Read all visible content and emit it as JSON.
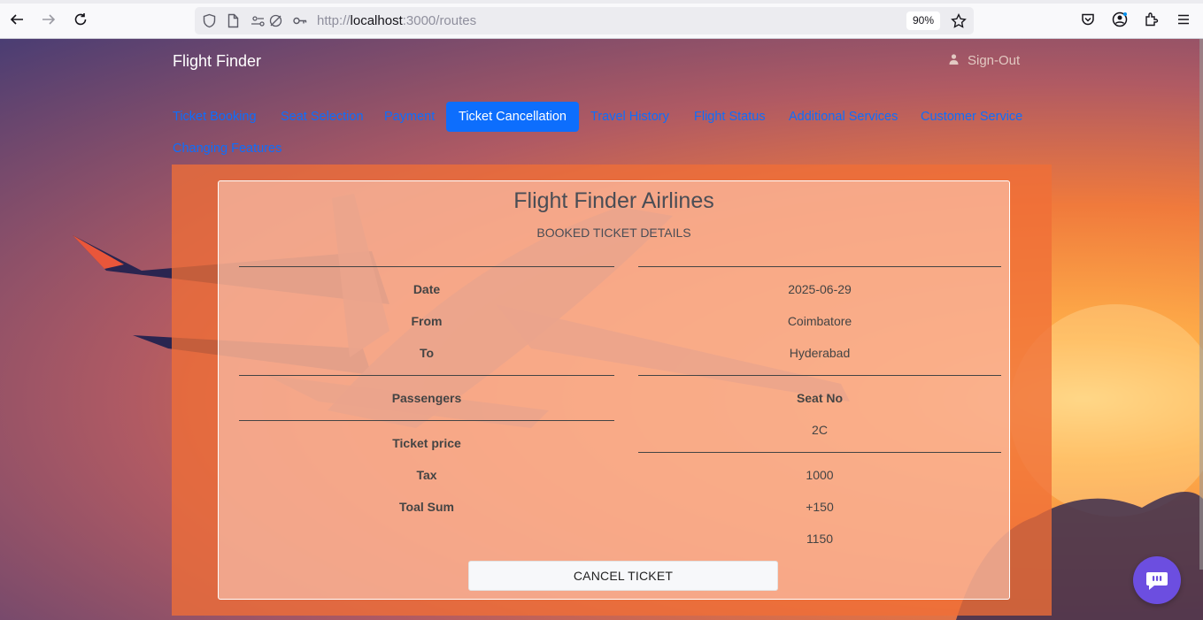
{
  "browser": {
    "url_prefix": "http://",
    "url_host": "localhost",
    "url_path": ":3000/routes",
    "zoom": "90%"
  },
  "header": {
    "brand": "Flight Finder",
    "signout_label": "Sign-Out"
  },
  "nav": {
    "tabs": [
      {
        "label": "Ticket Booking",
        "active": false
      },
      {
        "label": "Seat Selection",
        "active": false
      },
      {
        "label": "Payment",
        "active": false
      },
      {
        "label": "Ticket Cancellation",
        "active": true
      },
      {
        "label": "Travel History",
        "active": false
      },
      {
        "label": "Flight Status",
        "active": false
      },
      {
        "label": "Additional Services",
        "active": false
      },
      {
        "label": "Customer Service",
        "active": false
      },
      {
        "label": "Changing Features",
        "active": false
      }
    ]
  },
  "ticket": {
    "title": "Flight Finder Airlines",
    "subtitle": "BOOKED TICKET DETAILS",
    "labels": {
      "date": "Date",
      "from": "From",
      "to": "To",
      "passengers": "Passengers",
      "ticket_price": "Ticket price",
      "tax": "Tax",
      "total_sum": "Toal Sum"
    },
    "values": {
      "date": "2025-06-29",
      "from": "Coimbatore",
      "to": "Hyderabad",
      "seat_no_label": "Seat No",
      "seat_no": "2C",
      "price": "1000",
      "tax": "+150",
      "total": "1150"
    },
    "cancel_label": "CANCEL TICKET"
  },
  "colors": {
    "accent": "#0d6efd",
    "chatbot": "#6c4ee0"
  }
}
